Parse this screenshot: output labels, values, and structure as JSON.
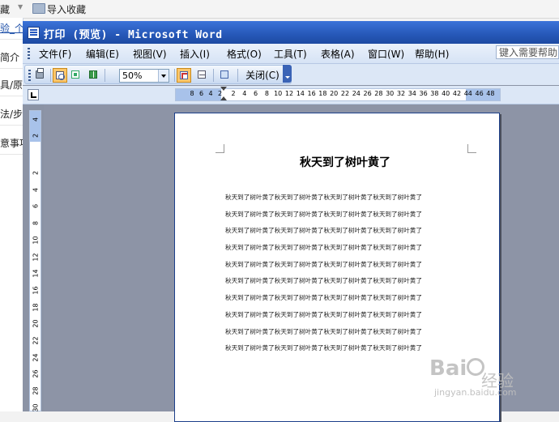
{
  "browser": {
    "favorites_menu": "藏",
    "import_favorites": "导入收藏"
  },
  "background_page": {
    "items": [
      "验_个",
      "简介",
      "具/原",
      "法/步",
      "意事项"
    ]
  },
  "word": {
    "title": "打印 (预览) - Microsoft Word",
    "menus": [
      "文件(F)",
      "编辑(E)",
      "视图(V)",
      "插入(I)",
      "格式(O)",
      "工具(T)",
      "表格(A)",
      "窗口(W)",
      "帮助(H)"
    ],
    "help_box_placeholder": "键入需要帮助",
    "toolbar": {
      "zoom": "50%",
      "close_label": "关闭(C)"
    },
    "hruler_ticks": [
      "8",
      "6",
      "4",
      "2",
      "2",
      "4",
      "6",
      "8",
      "10",
      "12",
      "14",
      "16",
      "18",
      "20",
      "22",
      "24",
      "26",
      "28",
      "30",
      "32",
      "34",
      "36",
      "38",
      "40",
      "42",
      "44",
      "46",
      "48"
    ],
    "vruler_ticks": [
      "4",
      "2",
      "2",
      "4",
      "6",
      "8",
      "10",
      "12",
      "14",
      "16",
      "18",
      "20",
      "22",
      "24",
      "26",
      "28",
      "30"
    ],
    "document": {
      "title": "秋天到了树叶黄了",
      "lines": [
        "秋天到了树叶黄了秋天到了树叶黄了秋天到了树叶黄了秋天到了树叶黄了",
        "秋天到了树叶黄了秋天到了树叶黄了秋天到了树叶黄了秋天到了树叶黄了",
        "秋天到了树叶黄了秋天到了树叶黄了秋天到了树叶黄了秋天到了树叶黄了",
        "秋天到了树叶黄了秋天到了树叶黄了秋天到了树叶黄了秋天到了树叶黄了",
        "秋天到了树叶黄了秋天到了树叶黄了秋天到了树叶黄了秋天到了树叶黄了",
        "秋天到了树叶黄了秋天到了树叶黄了秋天到了树叶黄了秋天到了树叶黄了",
        "秋天到了树叶黄了秋天到了树叶黄了秋天到了树叶黄了秋天到了树叶黄了",
        "秋天到了树叶黄了秋天到了树叶黄了秋天到了树叶黄了秋天到了树叶黄了",
        "秋天到了树叶黄了秋天到了树叶黄了秋天到了树叶黄了秋天到了树叶黄了",
        "秋天到了树叶黄了秋天到了树叶黄了秋天到了树叶黄了秋天到了树叶黄了"
      ]
    }
  },
  "watermark": {
    "brand": "Bai",
    "brand2": "经验",
    "url": "jingyan.baidu.com"
  }
}
